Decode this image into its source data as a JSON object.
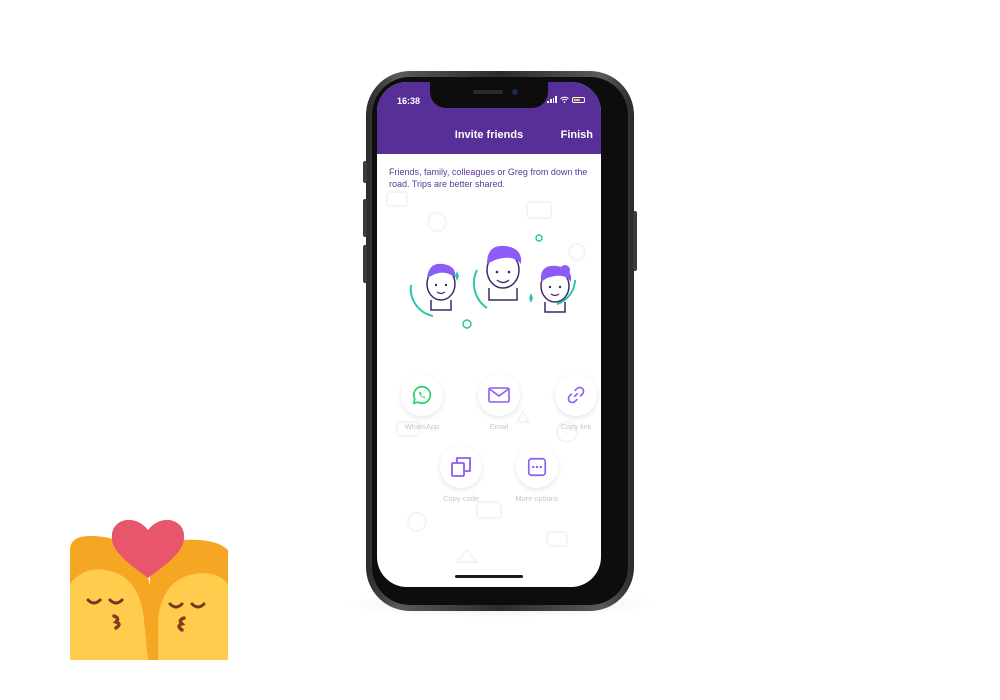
{
  "status_bar": {
    "time": "16:38"
  },
  "header": {
    "title": "Invite friends",
    "finish_label": "Finish"
  },
  "description": "Friends, family, colleagues or Greg from down the road. Trips are better shared.",
  "share_options": [
    {
      "label": "WhatsApp",
      "icon": "whatsapp-icon"
    },
    {
      "label": "Email",
      "icon": "email-icon"
    },
    {
      "label": "Copy link",
      "icon": "link-icon"
    },
    {
      "label": "Copy code",
      "icon": "copy-icon"
    },
    {
      "label": "More options",
      "icon": "more-icon"
    }
  ],
  "colors": {
    "header_bg": "#563096",
    "accent_purple": "#8b5cf6",
    "accent_teal": "#2ec4a6",
    "whatsapp_green": "#25d366",
    "label_gray": "#c9c4d4"
  }
}
